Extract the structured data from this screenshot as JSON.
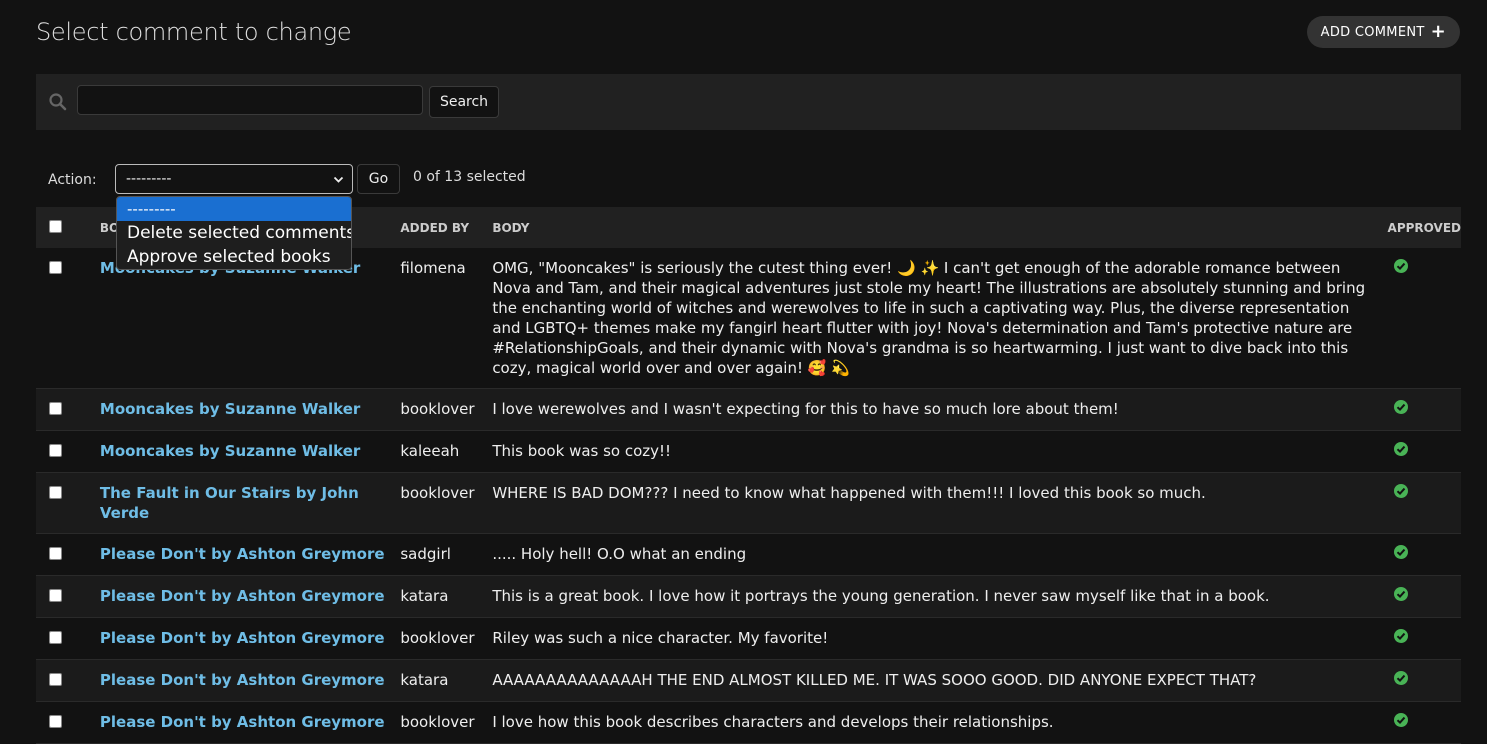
{
  "header": {
    "title": "Select comment to change",
    "add_label": "ADD COMMENT"
  },
  "search": {
    "value": "",
    "placeholder": "",
    "button": "Search"
  },
  "actions": {
    "label": "Action:",
    "selected": "---------",
    "go": "Go",
    "count": "0 of 13 selected",
    "options": [
      "---------",
      "Delete selected comments",
      "Approve selected books"
    ]
  },
  "table": {
    "headers": [
      "Book",
      "Added by",
      "Body",
      "Approved"
    ],
    "rows": [
      {
        "book": "Mooncakes by Suzanne Walker",
        "user": "filomena",
        "body": "OMG, \"Mooncakes\" is seriously the cutest thing ever! 🌙 ✨ I can't get enough of the adorable romance between Nova and Tam, and their magical adventures just stole my heart! The illustrations are absolutely stunning and bring the enchanting world of witches and werewolves to life in such a captivating way. Plus, the diverse representation and LGBTQ+ themes make my fangirl heart flutter with joy! Nova's determination and Tam's protective nature are #RelationshipGoals, and their dynamic with Nova's grandma is so heartwarming. I just want to dive back into this cozy, magical world over and over again! 🥰 💫",
        "approved": true
      },
      {
        "book": "Mooncakes by Suzanne Walker",
        "user": "booklover",
        "body": "I love werewolves and I wasn't expecting for this to have so much lore about them!",
        "approved": true
      },
      {
        "book": "Mooncakes by Suzanne Walker",
        "user": "kaleeah",
        "body": "This book was so cozy!!",
        "approved": true
      },
      {
        "book": "The Fault in Our Stairs by John Verde",
        "user": "booklover",
        "body": "WHERE IS BAD DOM??? I need to know what happened with them!!! I loved this book so much.",
        "approved": true
      },
      {
        "book": "Please Don't by Ashton Greymore",
        "user": "sadgirl",
        "body": "..... Holy hell! O.O what an ending",
        "approved": true
      },
      {
        "book": "Please Don't by Ashton Greymore",
        "user": "katara",
        "body": "This is a great book. I love how it portrays the young generation. I never saw myself like that in a book.",
        "approved": true
      },
      {
        "book": "Please Don't by Ashton Greymore",
        "user": "booklover",
        "body": "Riley was such a nice character. My favorite!",
        "approved": true
      },
      {
        "book": "Please Don't by Ashton Greymore",
        "user": "katara",
        "body": "AAAAAAAAAAAAAAH THE END ALMOST KILLED ME. IT WAS SOOO GOOD. DID ANYONE EXPECT THAT?",
        "approved": true
      },
      {
        "book": "Please Don't by Ashton Greymore",
        "user": "booklover",
        "body": "I love how this book describes characters and develops their relationships.",
        "approved": true
      }
    ]
  },
  "colors": {
    "link": "#6fbde6",
    "approved": "#49b356",
    "selected_option": "#1a6fd1"
  }
}
